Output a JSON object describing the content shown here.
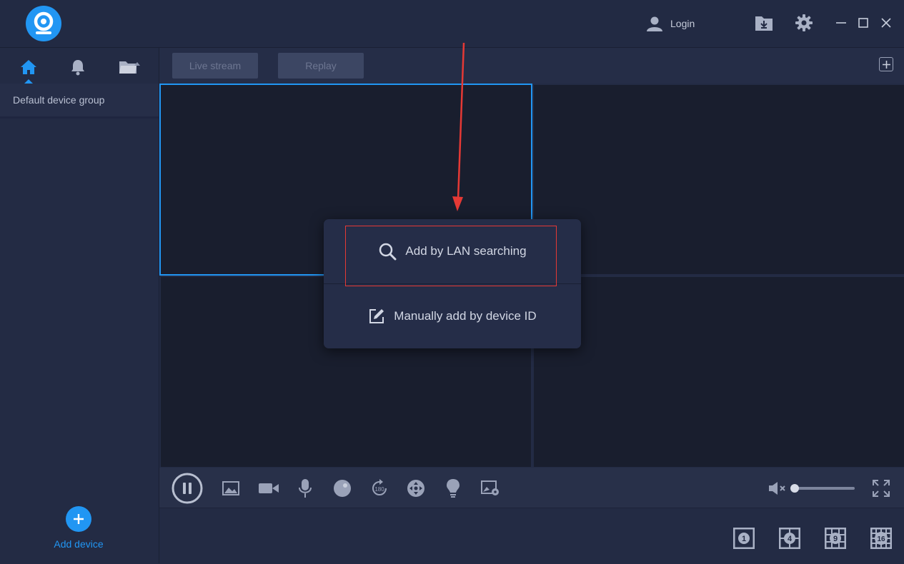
{
  "header": {
    "login_label": "Login"
  },
  "sidebar": {
    "group_label": "Default device group",
    "add_device_label": "Add device"
  },
  "toolbar": {
    "live_stream_label": "Live stream",
    "replay_label": "Replay"
  },
  "popup": {
    "lan_search_label": "Add by LAN searching",
    "manual_add_label": "Manually add by device ID"
  },
  "layout_buttons": [
    "1",
    "4",
    "9",
    "16"
  ],
  "colors": {
    "accent": "#2196f3",
    "background": "#232b44",
    "pane": "#191e2e",
    "highlight": "#e53935",
    "arrow": "#e53935"
  },
  "icons": [
    "app-logo-icon",
    "user-icon",
    "download-folder-icon",
    "gear-icon",
    "minimize-icon",
    "maximize-icon",
    "close-icon",
    "home-icon",
    "bell-icon",
    "folder-icon",
    "plus-icon",
    "pause-icon",
    "snapshot-icon",
    "record-icon",
    "mic-icon",
    "sphere-icon",
    "rotate-180-icon",
    "ptz-icon",
    "bulb-icon",
    "image-settings-icon",
    "mute-icon",
    "fullscreen-icon",
    "search-icon",
    "edit-icon"
  ]
}
